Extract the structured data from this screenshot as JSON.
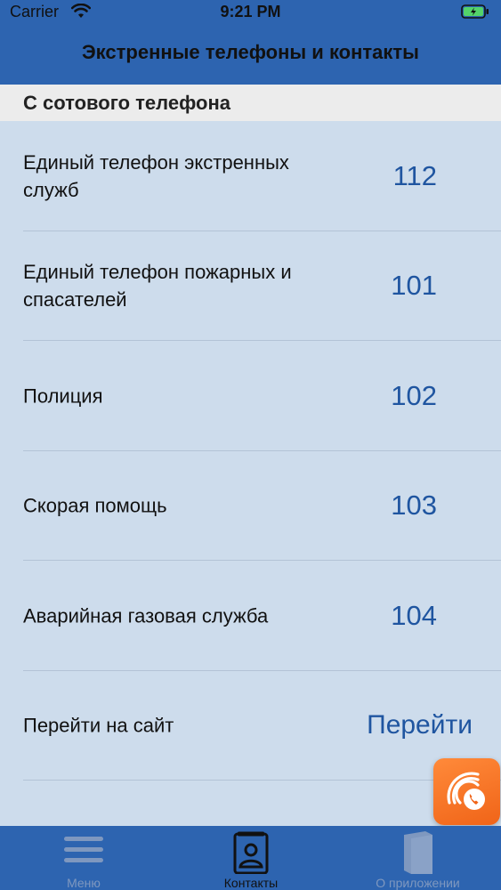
{
  "status_bar": {
    "carrier": "Carrier",
    "time": "9:21 PM"
  },
  "header": {
    "title": "Экстренные телефоны и контакты"
  },
  "section": {
    "title": "С сотового телефона"
  },
  "rows": [
    {
      "label": "Единый телефон экстренных служб",
      "value": "112"
    },
    {
      "label": "Единый телефон пожарных и спасателей",
      "value": "101"
    },
    {
      "label": "Полиция",
      "value": "102"
    },
    {
      "label": "Скорая помощь",
      "value": "103"
    },
    {
      "label": "Аварийная газовая служба",
      "value": "104"
    },
    {
      "label": "Перейти на сайт",
      "value": "Перейти"
    }
  ],
  "tabbar": {
    "items": [
      {
        "label": "Меню",
        "icon": "menu-icon"
      },
      {
        "label": "Контакты",
        "icon": "contacts-icon"
      },
      {
        "label": "О приложении",
        "icon": "book-icon"
      }
    ],
    "active_index": 1
  },
  "fab": {
    "icon": "phone-call-icon"
  },
  "colors": {
    "primary": "#2d64b0",
    "background": "#cddcec",
    "link": "#1f55a0",
    "accent": "#f06418"
  }
}
